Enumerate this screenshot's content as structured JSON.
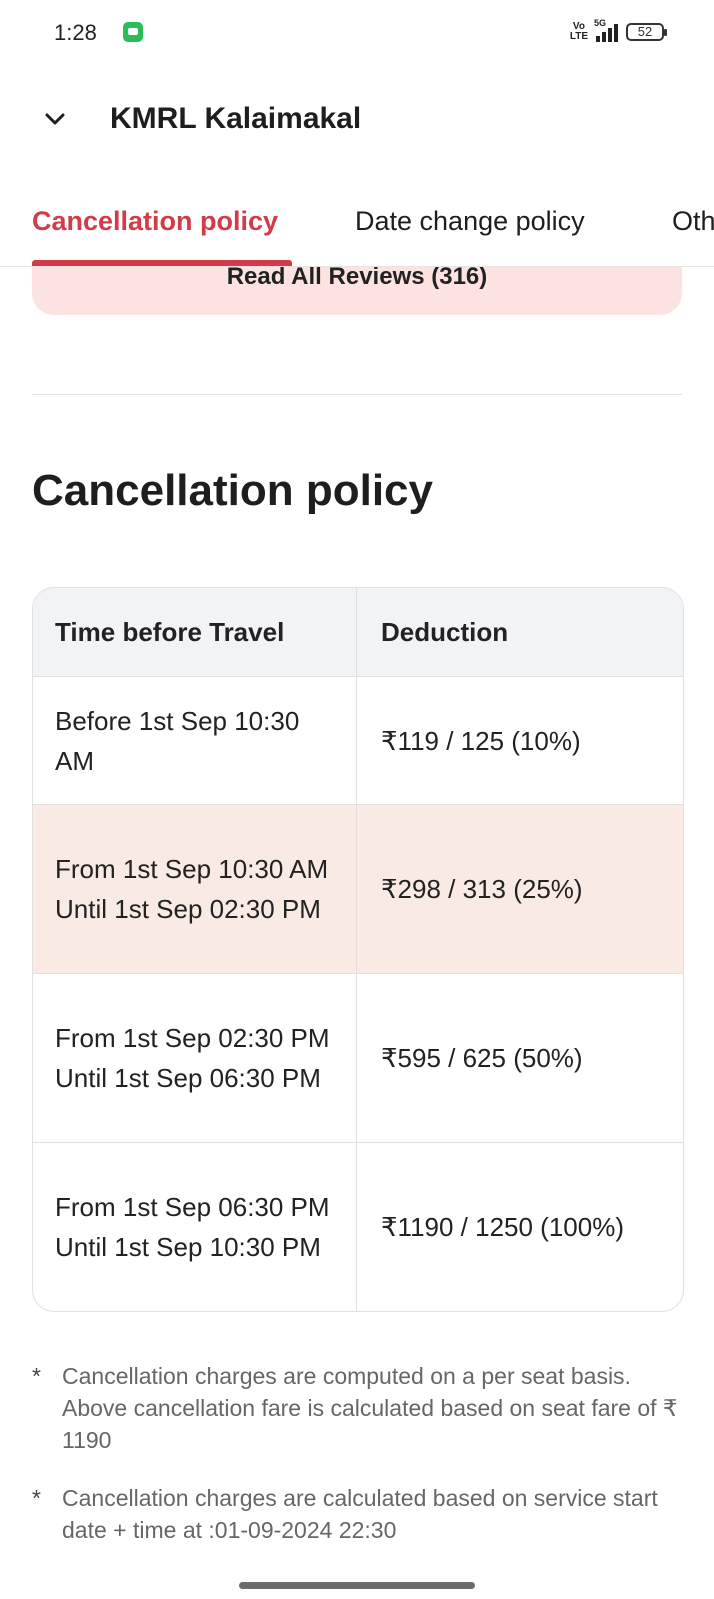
{
  "status_bar": {
    "time": "1:28",
    "network": "5G",
    "volte": "Vo\nLTE",
    "battery": "52"
  },
  "header": {
    "title": "KMRL Kalaimakal"
  },
  "tabs": [
    {
      "label": "Cancellation policy",
      "active": true
    },
    {
      "label": "Date change policy",
      "active": false
    },
    {
      "label": "Oth",
      "active": false
    }
  ],
  "reviews_button": {
    "label": "Read All Reviews (316)"
  },
  "section": {
    "title": "Cancellation policy"
  },
  "table": {
    "headers": [
      "Time before Travel",
      "Deduction"
    ],
    "rows": [
      {
        "time": "Before 1st Sep 10:30 AM",
        "deduction": "₹119 / 125 (10%)",
        "highlighted": false
      },
      {
        "time": "From 1st Sep 10:30 AM Until 1st Sep 02:30 PM",
        "deduction": "₹298 / 313 (25%)",
        "highlighted": true
      },
      {
        "time": "From 1st Sep 02:30 PM Until 1st Sep 06:30 PM",
        "deduction": "₹595 / 625 (50%)",
        "highlighted": false
      },
      {
        "time": "From 1st Sep 06:30 PM Until 1st Sep 10:30 PM",
        "deduction": "₹1190 / 1250 (100%)",
        "highlighted": false
      }
    ]
  },
  "notes": [
    {
      "bullet": "*",
      "text": "Cancellation charges are computed on a per seat basis. Above cancellation fare is calculated based on seat fare of ₹ 1190"
    },
    {
      "bullet": "*",
      "text": "Cancellation charges are calculated based on service start date + time at :01-09-2024 22:30"
    }
  ],
  "colors": {
    "accent": "#d23b47",
    "highlight_row": "#f9ebe3",
    "reviews_bg": "#fde2e2",
    "table_header_bg": "#f2f3f7"
  }
}
